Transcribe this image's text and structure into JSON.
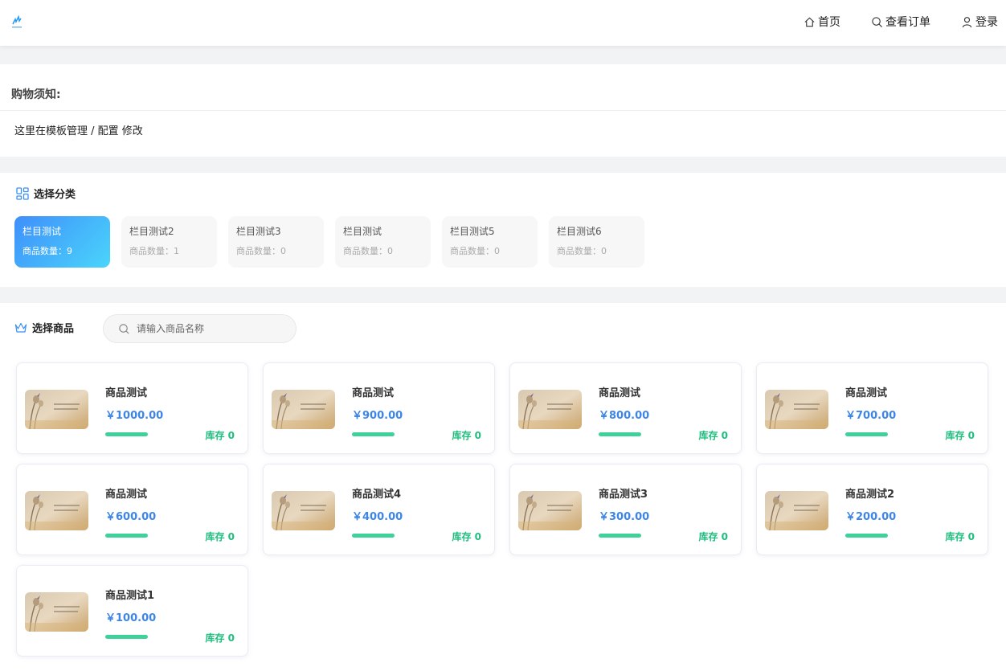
{
  "header": {
    "nav": [
      {
        "label": "首页",
        "icon": "home-icon"
      },
      {
        "label": "查看订单",
        "icon": "search-icon"
      },
      {
        "label": "登录",
        "icon": "user-icon"
      }
    ]
  },
  "notice": {
    "title": "购物须知:",
    "text": "这里在模板管理 / 配置 修改"
  },
  "categories": {
    "title": "选择分类",
    "icon": "grid-icon",
    "items": [
      {
        "name": "栏目测试",
        "count": "商品数量：9",
        "active": true
      },
      {
        "name": "栏目测试2",
        "count": "商品数量：1",
        "active": false
      },
      {
        "name": "栏目测试3",
        "count": "商品数量：0",
        "active": false
      },
      {
        "name": "栏目测试",
        "count": "商品数量：0",
        "active": false
      },
      {
        "name": "栏目测试5",
        "count": "商品数量：0",
        "active": false
      },
      {
        "name": "栏目测试6",
        "count": "商品数量：0",
        "active": false
      }
    ]
  },
  "products": {
    "title": "选择商品",
    "icon": "crown-icon",
    "search_placeholder": "请输入商品名称",
    "items": [
      {
        "name": "商品测试",
        "price": "￥1000.00",
        "stock": "库存 0"
      },
      {
        "name": "商品测试",
        "price": "￥900.00",
        "stock": "库存 0"
      },
      {
        "name": "商品测试",
        "price": "￥800.00",
        "stock": "库存 0"
      },
      {
        "name": "商品测试",
        "price": "￥700.00",
        "stock": "库存 0"
      },
      {
        "name": "商品测试",
        "price": "￥600.00",
        "stock": "库存 0"
      },
      {
        "name": "商品测试4",
        "price": "￥400.00",
        "stock": "库存 0"
      },
      {
        "name": "商品测试3",
        "price": "￥300.00",
        "stock": "库存 0"
      },
      {
        "name": "商品测试2",
        "price": "￥200.00",
        "stock": "库存 0"
      },
      {
        "name": "商品测试1",
        "price": "￥100.00",
        "stock": "库存 0"
      }
    ]
  },
  "colors": {
    "accent_blue": "#3d85e6",
    "stock_green": "#1fbe7e",
    "active_gradient_start": "#3f8ffb",
    "active_gradient_end": "#4ad5fb"
  }
}
